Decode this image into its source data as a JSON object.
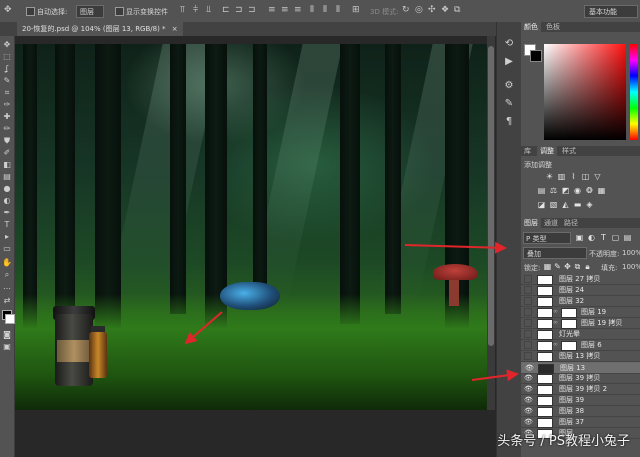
{
  "options_bar": {
    "auto_select_label": "自动选择:",
    "auto_select_value": "图层",
    "show_transform_label": "显示变换控件",
    "mode_3d_label": "3D 模式:",
    "workspace": "基本功能"
  },
  "document": {
    "tab_title": "20-恢复的.psd @ 104% (图层 13, RGB/8) *"
  },
  "panels": {
    "color_tabs": [
      "颜色",
      "色板"
    ],
    "adjust_tabs": [
      "库",
      "调整",
      "样式"
    ],
    "adjust_add_label": "添加调整",
    "layers_tabs": [
      "图层",
      "通道",
      "路径"
    ],
    "filter_kind": "P 类型",
    "blend_mode": "叠加",
    "opacity_label": "不透明度:",
    "opacity_value": "100%",
    "lock_label": "锁定:",
    "fill_label": "填充:",
    "fill_value": "100%"
  },
  "layers": [
    {
      "name": "图层 27 拷贝",
      "visible": false,
      "mask": false
    },
    {
      "name": "图层 24",
      "visible": false,
      "mask": false
    },
    {
      "name": "图层 32",
      "visible": false,
      "mask": false
    },
    {
      "name": "图层 19",
      "visible": false,
      "mask": true
    },
    {
      "name": "图层 19 拷贝",
      "visible": false,
      "mask": true
    },
    {
      "name": "灯光晕",
      "visible": false,
      "mask": false
    },
    {
      "name": "图层 6",
      "visible": false,
      "mask": true
    },
    {
      "name": "图层 13 拷贝",
      "visible": false,
      "mask": false
    },
    {
      "name": "图层 13",
      "visible": true,
      "mask": false,
      "selected": true
    },
    {
      "name": "图层 39 拷贝",
      "visible": true,
      "mask": false
    },
    {
      "name": "图层 39 拷贝 2",
      "visible": true,
      "mask": false
    },
    {
      "name": "图层 39",
      "visible": true,
      "mask": false
    },
    {
      "name": "图层 38",
      "visible": true,
      "mask": false
    },
    {
      "name": "图层 37",
      "visible": true,
      "mask": false
    },
    {
      "name": "图层",
      "visible": true,
      "mask": false
    }
  ],
  "watermark": "头条号 / PS教程小兔子",
  "colors": {
    "arrow": "#e0262b",
    "panel_bg": "#535353",
    "selected_row": "#6f6f6f"
  },
  "icons": {
    "move_tool": "move-icon",
    "eye": "eye-icon"
  }
}
